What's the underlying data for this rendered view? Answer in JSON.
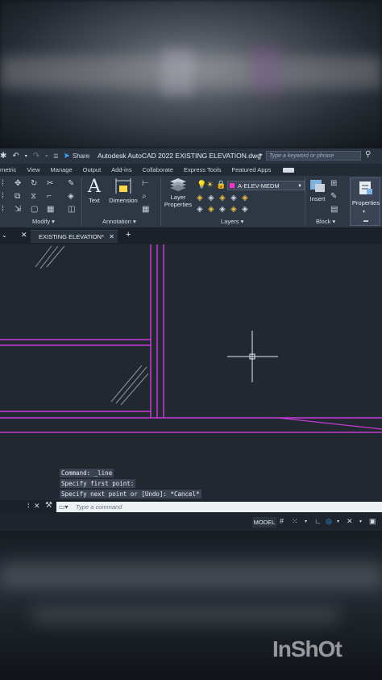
{
  "app": {
    "title": "Autodesk AutoCAD 2022   EXISTING ELEVATION.dwg",
    "share_label": "Share",
    "search_placeholder": "Type a keyword or phrase"
  },
  "menu": [
    "metric",
    "View",
    "Manage",
    "Output",
    "Add-ins",
    "Collaborate",
    "Express Tools",
    "Featured Apps"
  ],
  "ribbon": {
    "modify_label": "Modify ▾",
    "text_label": "Text",
    "dimension_label": "Dimension",
    "annotation_label": "Annotation ▾",
    "layer_properties_label": "Layer\nProperties",
    "layer_name": "A-ELEV-MEDM",
    "layers_label": "Layers ▾",
    "insert_label": "Insert",
    "block_label": "Block ▾",
    "properties_label": "Properties",
    "accent_color": "#ff2ec8"
  },
  "doc_tab": {
    "label": "EXISTING ELEVATION*"
  },
  "command_history": [
    "Command: _line",
    "Specify first point:",
    "Specify next point or [Undo]: *Cancel*"
  ],
  "command_input": {
    "placeholder": "Type a command"
  },
  "status": {
    "model_label": "MODEL"
  },
  "watermark": "InShOt",
  "colors": {
    "drawing_lines": "#c53bd6",
    "background": "#212830"
  }
}
